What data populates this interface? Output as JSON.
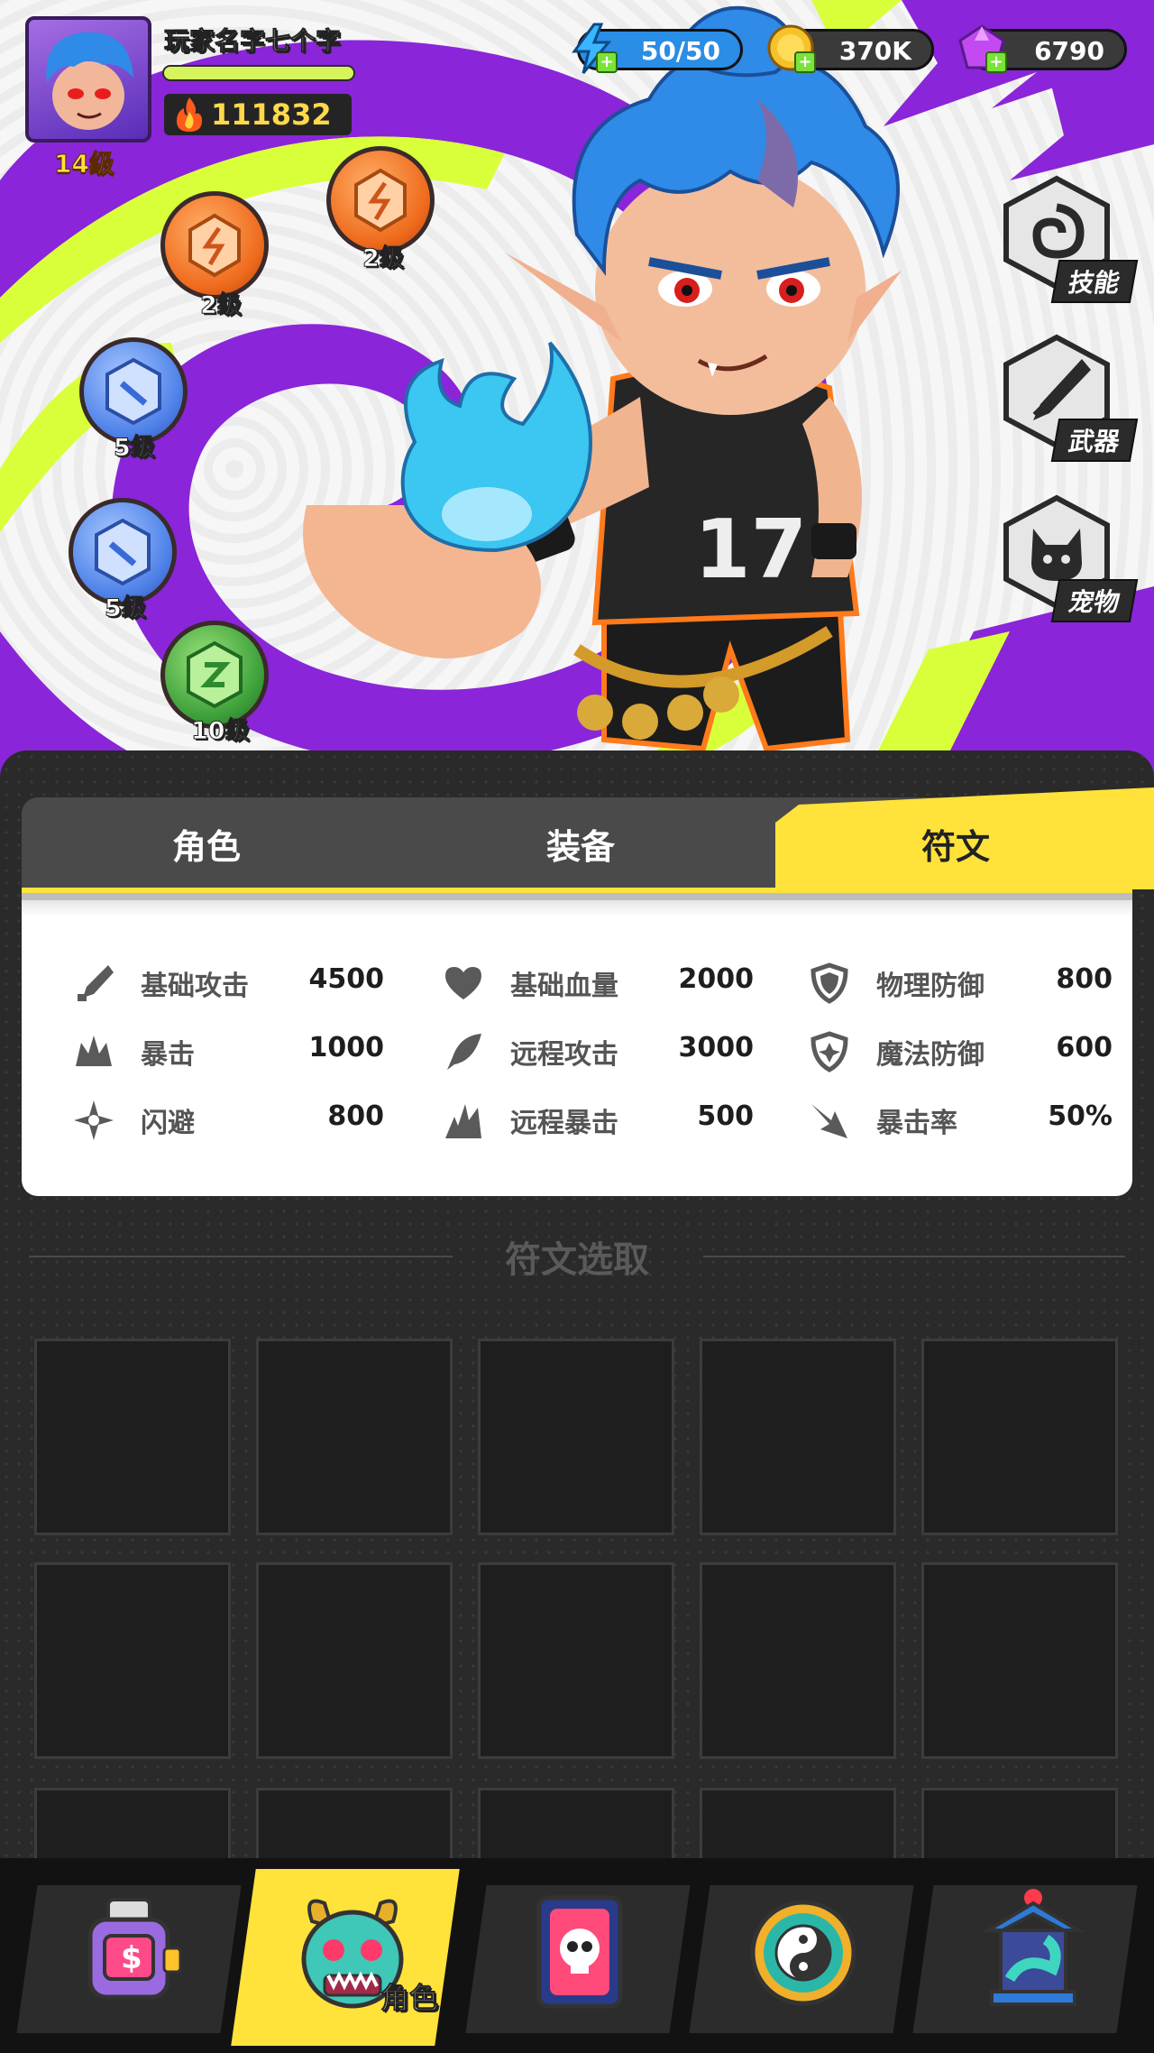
{
  "player": {
    "name": "玩家名字七个字",
    "level": "14级",
    "power": "111832"
  },
  "resources": {
    "energy": "50/50",
    "gold": "370K",
    "gems": "6790"
  },
  "runes": [
    {
      "color": "orange",
      "level": "2级"
    },
    {
      "color": "orange",
      "level": "2级"
    },
    {
      "color": "blue",
      "level": "5级"
    },
    {
      "color": "blue",
      "level": "5级"
    },
    {
      "color": "green",
      "level": "10级"
    }
  ],
  "side_buttons": {
    "skill": "技能",
    "weapon": "武器",
    "pet": "宠物"
  },
  "hero": {
    "jersey_number": "17"
  },
  "tabs": [
    {
      "label": "角色",
      "active": false
    },
    {
      "label": "装备",
      "active": false
    },
    {
      "label": "符文",
      "active": true
    }
  ],
  "stats": [
    {
      "icon": "sword-icon",
      "label": "基础攻击",
      "value": "4500"
    },
    {
      "icon": "heart-icon",
      "label": "基础血量",
      "value": "2000"
    },
    {
      "icon": "shield-icon",
      "label": "物理防御",
      "value": "800"
    },
    {
      "icon": "crit-icon",
      "label": "暴击",
      "value": "1000"
    },
    {
      "icon": "feather-icon",
      "label": "远程攻击",
      "value": "3000"
    },
    {
      "icon": "magic-shield-icon",
      "label": "魔法防御",
      "value": "600"
    },
    {
      "icon": "dodge-icon",
      "label": "闪避",
      "value": "800"
    },
    {
      "icon": "ranged-crit-icon",
      "label": "远程暴击",
      "value": "500"
    },
    {
      "icon": "crit-rate-icon",
      "label": "暴击率",
      "value": "50%"
    }
  ],
  "rune_select": {
    "title": "符文选取"
  },
  "bottom_nav": [
    {
      "icon": "shop-watch-icon",
      "label": ""
    },
    {
      "icon": "character-demon-icon",
      "label": "角色",
      "active": true
    },
    {
      "icon": "skull-card-icon",
      "label": ""
    },
    {
      "icon": "yin-yang-icon",
      "label": ""
    },
    {
      "icon": "pagoda-icon",
      "label": ""
    }
  ],
  "colors": {
    "accent_yellow": "#ffe23a",
    "purple": "#7e22d6",
    "lime": "#d9ff3a",
    "panel_dark": "#2a2a2a"
  }
}
